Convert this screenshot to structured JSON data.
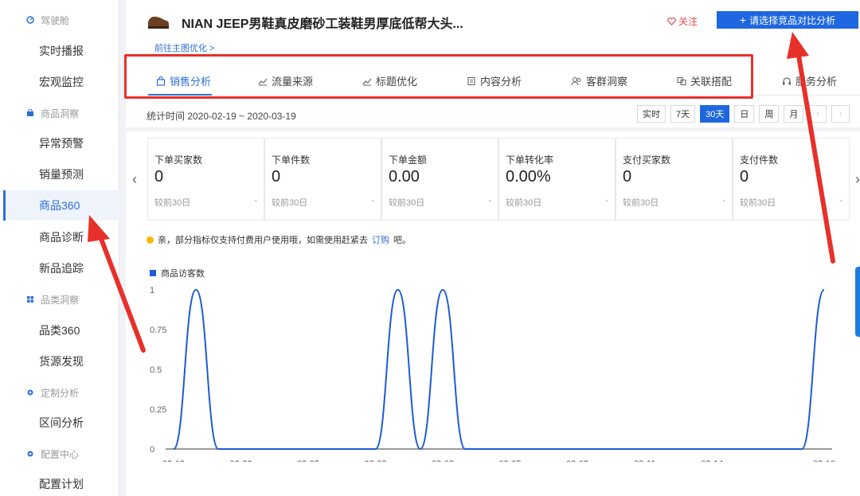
{
  "sidebar": {
    "sections": [
      {
        "label": "驾驶舱",
        "icon": "dashboard-icon"
      },
      {
        "label": "商品洞察",
        "icon": "bag-icon"
      },
      {
        "label": "品类洞察",
        "icon": "grid-icon"
      },
      {
        "label": "定制分析",
        "icon": "gear-icon"
      },
      {
        "label": "配置中心",
        "icon": "config-icon"
      }
    ],
    "items": [
      {
        "label": "实时播报"
      },
      {
        "label": "宏观监控"
      },
      {
        "label": "异常预警"
      },
      {
        "label": "销量预测"
      },
      {
        "label": "商品360",
        "active": true
      },
      {
        "label": "商品诊断"
      },
      {
        "label": "新品追踪"
      },
      {
        "label": "品类360"
      },
      {
        "label": "货源发现"
      },
      {
        "label": "区间分析"
      },
      {
        "label": "配置计划"
      }
    ]
  },
  "header": {
    "product_title": "NIAN JEEP男鞋真皮磨砂工装鞋男厚底低帮大头...",
    "follow_label": "关注",
    "compare_button": "请选择竞品对比分析",
    "goto_link": "前往主图优化 >"
  },
  "tabs": [
    {
      "label": "销售分析",
      "icon": "bag-icon",
      "active": true
    },
    {
      "label": "流量来源",
      "icon": "line-chart-icon"
    },
    {
      "label": "标题优化",
      "icon": "line-chart-icon"
    },
    {
      "label": "内容分析",
      "icon": "document-icon"
    },
    {
      "label": "客群洞察",
      "icon": "users-icon"
    },
    {
      "label": "关联搭配",
      "icon": "link-icon"
    },
    {
      "label": "服务分析",
      "icon": "headset-icon"
    }
  ],
  "stat_range": "统计时间 2020-02-19 ~ 2020-03-19",
  "range_buttons": [
    "实时",
    "7天",
    "30天",
    "日",
    "周",
    "月"
  ],
  "active_range": "30天",
  "metrics": [
    {
      "label": "下单买家数",
      "value": "0",
      "compare": "较前30日",
      "change": "-"
    },
    {
      "label": "下单件数",
      "value": "0",
      "compare": "较前30日",
      "change": "-"
    },
    {
      "label": "下单金额",
      "value": "0.00",
      "compare": "较前30日",
      "change": "-"
    },
    {
      "label": "下单转化率",
      "value": "0.00%",
      "compare": "较前30日",
      "change": "-"
    },
    {
      "label": "支付买家数",
      "value": "0",
      "compare": "较前30日",
      "change": "-"
    },
    {
      "label": "支付件数",
      "value": "0",
      "compare": "较前30日",
      "change": "-"
    }
  ],
  "notice": {
    "text": "亲，部分指标仅支持付费用户使用哦，如需使用赶紧去",
    "link": "订购",
    "suffix": "吧。"
  },
  "colors": {
    "primary": "#1f67e0",
    "alert": "#e8302a",
    "series": "#1f5bd6"
  },
  "chart_data": {
    "type": "line",
    "series": [
      {
        "name": "商品访客数",
        "values": [
          0,
          1,
          0,
          0,
          0,
          0,
          0,
          0,
          0,
          0,
          1,
          0,
          1,
          0,
          0,
          0,
          0,
          0,
          0,
          0,
          0,
          0,
          0,
          0,
          0,
          0,
          0,
          0,
          0,
          1
        ]
      }
    ],
    "x_ticks": [
      "02-19",
      "02-22",
      "02-25",
      "02-28",
      "03-02",
      "03-05",
      "03-08",
      "03-11",
      "03-14",
      "03-19"
    ],
    "y_ticks": [
      "0",
      "0.25",
      "0.5",
      "0.75",
      "1"
    ],
    "ylim": [
      0,
      1
    ],
    "legend": "top-left"
  }
}
